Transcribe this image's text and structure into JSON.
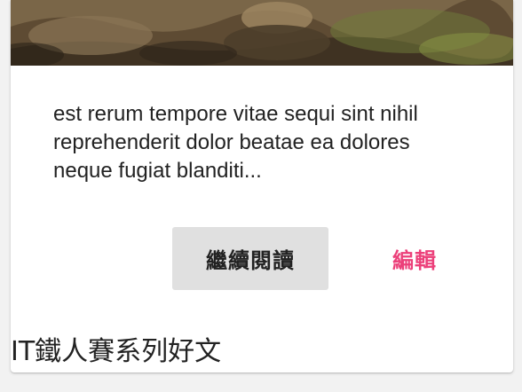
{
  "card": {
    "excerpt": "est rerum tempore vitae sequi sint nihil reprehenderit dolor beatae ea dolores neque fugiat blanditi...",
    "continue_label": "繼續閱讀",
    "edit_label": "編輯",
    "footer_title": "IT鐵人賽系列好文"
  },
  "colors": {
    "edit_accent": "#ec407a",
    "button_bg": "#e0e0e0",
    "card_bg": "#ffffff",
    "page_bg": "#f2f2f2"
  }
}
